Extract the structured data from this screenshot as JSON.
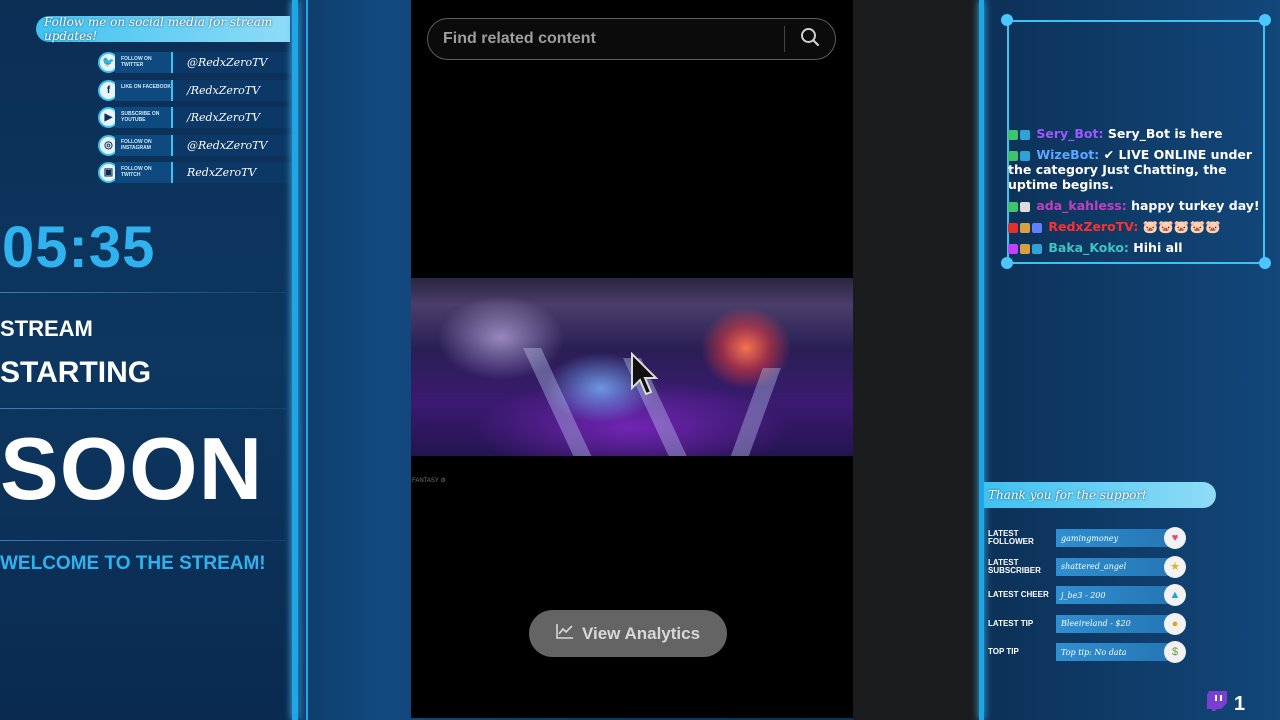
{
  "left": {
    "social_banner": "Follow me on social media for stream updates!",
    "socials": [
      {
        "icon": "twitter-icon",
        "glyph": "🐦",
        "label": "FOLLOW ON TWITTER",
        "handle": "@RedxZeroTV"
      },
      {
        "icon": "facebook-icon",
        "glyph": "f",
        "label": "LIKE ON FACEBOOK",
        "handle": "/RedxZeroTV"
      },
      {
        "icon": "youtube-icon",
        "glyph": "▶",
        "label": "SUBSCRIBE ON YOUTUBE",
        "handle": "/RedxZeroTV"
      },
      {
        "icon": "instagram-icon",
        "glyph": "◎",
        "label": "FOLLOW ON INSTAGRAM",
        "handle": "@RedxZeroTV"
      },
      {
        "icon": "twitch-icon",
        "glyph": "▣",
        "label": "FOLLOW ON TWITCH",
        "handle": "RedxZeroTV"
      }
    ],
    "timer": "05:35",
    "stream": "STREAM",
    "starting": "STARTING",
    "soon": "SOON",
    "welcome": "WELCOME TO THE STREAM!"
  },
  "center": {
    "search_placeholder": "Find related content",
    "analytics_label": "View Analytics",
    "caption": "FANTASY ⚙"
  },
  "chat": {
    "messages": [
      {
        "user": "Sery_Bot:",
        "color": "#9b59ff",
        "text": "Sery_Bot is here",
        "badges": [
          "#3ec46d",
          "#2fa3d6"
        ]
      },
      {
        "user": "WizeBot:",
        "color": "#5aa8ff",
        "text": "✔ LIVE ONLINE under the category Just Chatting, the uptime begins.",
        "badges": [
          "#3ec46d",
          "#2fa3d6"
        ]
      },
      {
        "user": "ada_kahless:",
        "color": "#c040c0",
        "text": "happy turkey day!",
        "badges": [
          "#3ec46d",
          "#dddddd"
        ]
      },
      {
        "user": "RedxZeroTV:",
        "color": "#ff3030",
        "text": "🐷🐷🐷🐷🐷",
        "badges": [
          "#e03030",
          "#d8a040",
          "#6080ff"
        ]
      },
      {
        "user": "Baka_Koko:",
        "color": "#3ec4c4",
        "text": "Hihi all",
        "badges": [
          "#c040ff",
          "#d8a040",
          "#2fa3d6"
        ]
      }
    ]
  },
  "support": {
    "banner": "Thank you for the support",
    "rows": [
      {
        "label": "LATEST FOLLOWER",
        "value": "gamingmoney",
        "icon": "heart-icon",
        "glyph": "♥",
        "color": "#e8456a"
      },
      {
        "label": "LATEST SUBSCRIBER",
        "value": "shattered_angel",
        "icon": "star-icon",
        "glyph": "★",
        "color": "#e8b020"
      },
      {
        "label": "LATEST CHEER",
        "value": "j_be3 - 200",
        "icon": "gem-icon",
        "glyph": "▲",
        "color": "#20a8c8"
      },
      {
        "label": "LATEST TIP",
        "value": "Bleeireland - $20",
        "icon": "coin-icon",
        "glyph": "●",
        "color": "#e8a020"
      },
      {
        "label": "TOP TIP",
        "value": "Top tip: No data",
        "icon": "moneybag-icon",
        "glyph": "$",
        "color": "#6a9a40"
      }
    ],
    "viewer_count": "1"
  },
  "colors": {
    "accent": "#1ea7e8",
    "timer": "#2fb2ee"
  }
}
